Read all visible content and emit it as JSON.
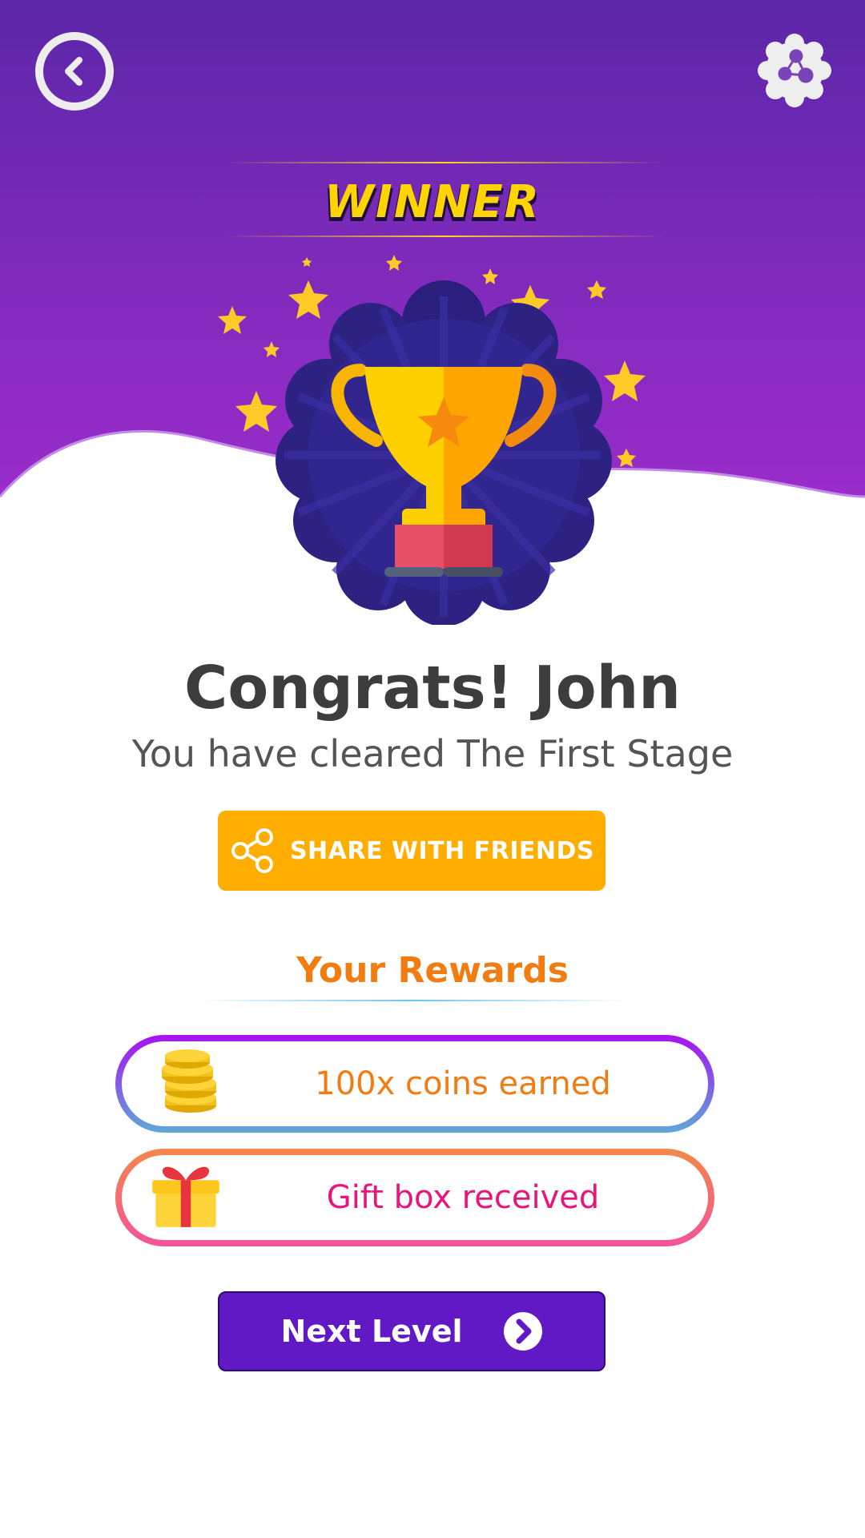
{
  "header": {
    "back_icon": "chevron-left-icon",
    "menu_icon": "molecule-share-icon"
  },
  "banner": {
    "title": "WINNER"
  },
  "illustration": {
    "icon": "trophy-icon",
    "decoration": "stars"
  },
  "result": {
    "headline": "Congrats! John",
    "message": "You have cleared The First Stage"
  },
  "share": {
    "label": "SHARE WITH FRIENDS",
    "icon": "share-icon"
  },
  "rewards": {
    "title": "Your Rewards",
    "items": [
      {
        "label": "100x coins earned",
        "icon": "coins-icon",
        "color": "#f07c12"
      },
      {
        "label": "Gift box received",
        "icon": "gift-icon",
        "color": "#e9157a"
      }
    ]
  },
  "next": {
    "label": "Next Level",
    "icon": "arrow-right-circle-icon"
  },
  "colors": {
    "hero_top": "#5b26a8",
    "hero_bottom": "#9c2ccc",
    "accent_orange": "#ffae00",
    "next_button": "#6119c6"
  }
}
